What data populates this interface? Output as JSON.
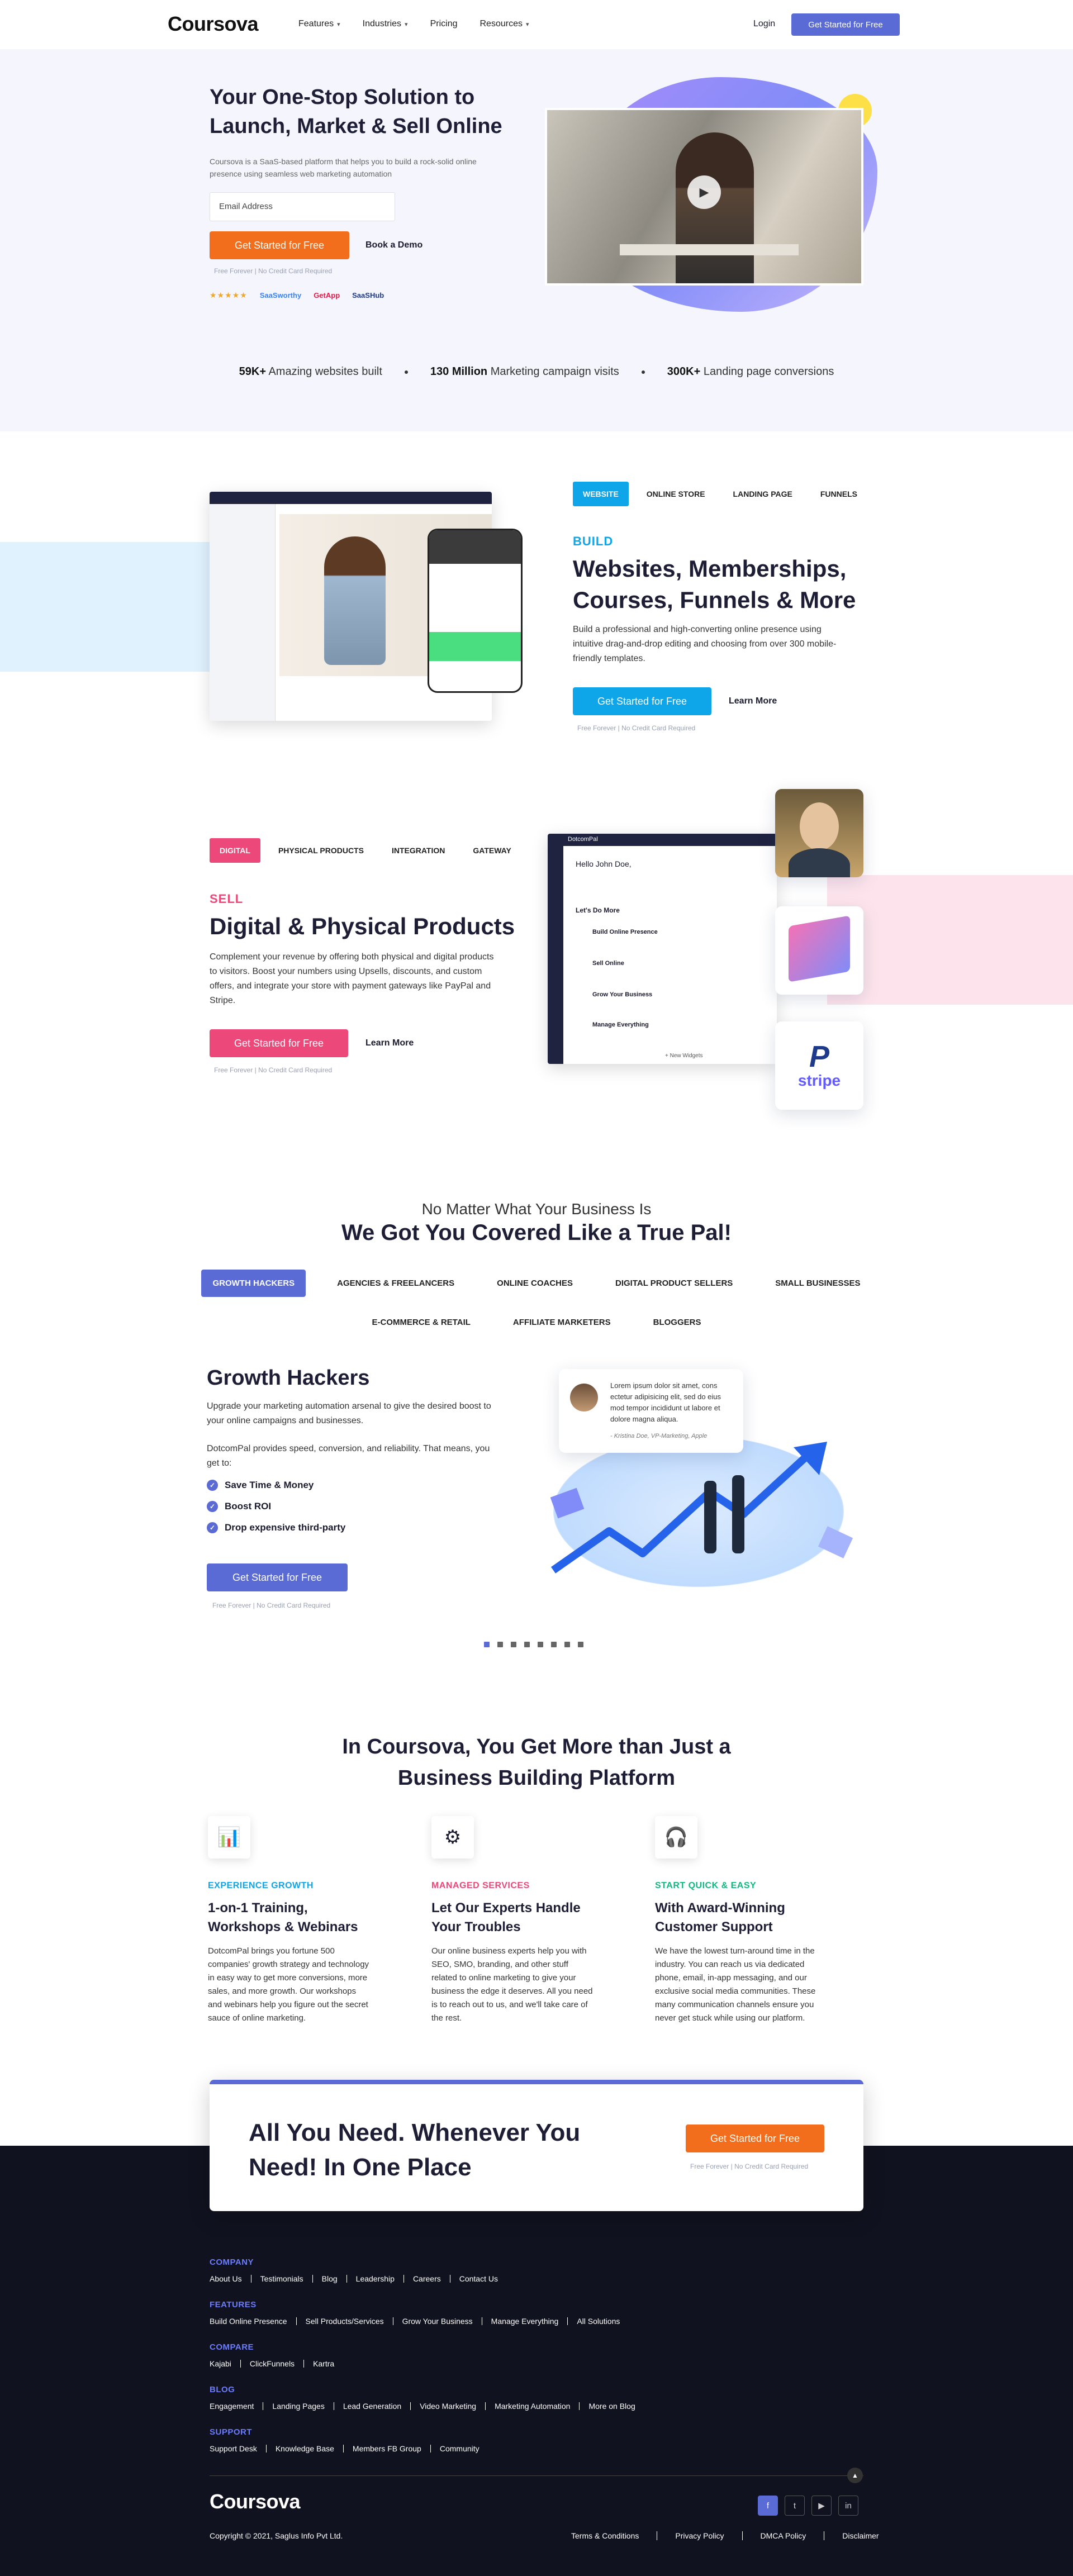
{
  "nav": {
    "logo": "Coursova",
    "links": [
      "Features",
      "Industries",
      "Pricing",
      "Resources"
    ],
    "login": "Login",
    "cta": "Get Started for Free"
  },
  "hero": {
    "title": "Your One-Stop Solution to Launch, Market & Sell Online",
    "subtitle": "Coursova is a SaaS-based platform that helps you to build a rock-solid online presence using seamless web marketing automation",
    "email_placeholder": "Email Address",
    "cta": "Get Started for Free",
    "book": "Book a Demo",
    "fine": "Free Forever  |  No Credit Card Required",
    "stars": "★★★★★",
    "badge2": "SaaSworthy",
    "badge3": "GetApp",
    "badge4": "SaaSHub"
  },
  "stats": [
    {
      "num": "59K+",
      "label": "Amazing websites built"
    },
    {
      "num": "130 Million",
      "label": "Marketing campaign visits"
    },
    {
      "num": "300K+",
      "label": "Landing page conversions"
    }
  ],
  "build": {
    "tabs": [
      "WEBSITE",
      "ONLINE STORE",
      "LANDING PAGE",
      "FUNNELS"
    ],
    "eyebrow": "BUILD",
    "title": "Websites, Memberships, Courses, Funnels & More",
    "text": "Build a professional and high-converting online presence using intuitive drag-and-drop editing and choosing from over 300 mobile-friendly templates.",
    "cta": "Get Started for Free",
    "learn": "Learn More",
    "fine": "Free Forever  |  No Credit Card Required"
  },
  "sell": {
    "tabs": [
      "DIGITAL",
      "PHYSICAL PRODUCTS",
      "INTEGRATION",
      "GATEWAY"
    ],
    "eyebrow": "SELL",
    "title": "Digital & Physical Products",
    "text": "Complement your revenue by offering both physical and digital products to visitors. Boost your numbers using Upsells, discounts, and custom offers, and integrate your store with payment gateways like PayPal and Stripe.",
    "cta": "Get Started for Free",
    "learn": "Learn More",
    "fine": "Free Forever  |  No Credit Card Required",
    "dash": {
      "brand": "DotcomPal",
      "greet": "Hello John Doe,",
      "lets": "Let's Do More",
      "items": [
        "Build Online Presence",
        "Sell Online",
        "Grow Your Business",
        "Manage Everything"
      ],
      "widgets": "+ New Widgets"
    },
    "stripe": "stripe"
  },
  "pal": {
    "pre": "No Matter What Your Business Is",
    "title": "We Got You Covered Like a True Pal!",
    "tabs_row1": [
      "GROWTH HACKERS",
      "AGENCIES & FREELANCERS",
      "ONLINE COACHES",
      "DIGITAL PRODUCT SELLERS",
      "SMALL BUSINESSES"
    ],
    "tabs_row2": [
      "E-COMMERCE & RETAIL",
      "AFFILIATE MARKETERS",
      "BLOGGERS"
    ],
    "heading": "Growth Hackers",
    "p1": "Upgrade your marketing automation arsenal to give the desired boost to your online campaigns and businesses.",
    "p2": "DotcomPal provides speed, conversion, and reliability. That means, you get to:",
    "checks": [
      "Save Time & Money",
      "Boost ROI",
      "Drop expensive third-party"
    ],
    "cta": "Get Started for Free",
    "fine": "Free Forever  |  No Credit Card Required",
    "quote": "Lorem ipsum dolor sit amet, cons ectetur adipisicing elit, sed do eius mod tempor incididunt ut labore et dolore magna aliqua.",
    "quote_by": "- Kristina Doe, VP-Marketing, Apple"
  },
  "more": {
    "title": "In Coursova, You Get More than Just a Business Building Platform",
    "features": [
      {
        "eyebrow": "EXPERIENCE GROWTH",
        "color": "#0ea5e9",
        "title": "1-on-1 Training, Workshops & Webinars",
        "text": "DotcomPal brings you fortune 500 companies' growth strategy and technology in easy way to get more conversions, more sales, and more growth. Our workshops and webinars help you figure out the secret sauce of online marketing."
      },
      {
        "eyebrow": "MANAGED SERVICES",
        "color": "#ec4879",
        "title": "Let Our Experts Handle Your Troubles",
        "text": "Our online business experts help you with SEO, SMO, branding, and other stuff related to online marketing to give your business the edge it deserves. All you need is to reach out to us, and we'll take care of the rest."
      },
      {
        "eyebrow": "START QUICK & EASY",
        "color": "#10b981",
        "title": "With Award-Winning Customer Support",
        "text": "We have the lowest turn-around time in the industry. You can reach us via dedicated phone, email, in-app messaging, and our exclusive social media communities. These many communication channels ensure you never get stuck while using our platform."
      }
    ]
  },
  "cta": {
    "title": "All You Need. Whenever You Need! In One Place",
    "button": "Get Started for Free",
    "fine": "Free Forever  |  No Credit Card Required"
  },
  "footer": {
    "sections": [
      {
        "title": "COMPANY",
        "links": [
          "About Us",
          "Testimonials",
          "Blog",
          "Leadership",
          "Careers",
          "Contact Us"
        ]
      },
      {
        "title": "FEATURES",
        "links": [
          "Build Online Presence",
          "Sell Products/Services",
          "Grow Your Business",
          "Manage Everything",
          "All Solutions"
        ]
      },
      {
        "title": "COMPARE",
        "links": [
          "Kajabi",
          "ClickFunnels",
          "Kartra"
        ]
      },
      {
        "title": "BLOG",
        "links": [
          "Engagement",
          "Landing Pages",
          "Lead Generation",
          "Video Marketing",
          "Marketing Automation",
          "More on Blog"
        ]
      },
      {
        "title": "SUPPORT",
        "links": [
          "Support Desk",
          "Knowledge Base",
          "Members FB Group",
          "Community"
        ]
      }
    ],
    "logo": "Coursova",
    "copyright": "Copyright © 2021, Saglus Info Pvt Ltd.",
    "legal": [
      "Terms & Conditions",
      "Privacy Policy",
      "DMCA Policy",
      "Disclaimer"
    ],
    "social": [
      "f",
      "t",
      "▶",
      "in"
    ]
  }
}
